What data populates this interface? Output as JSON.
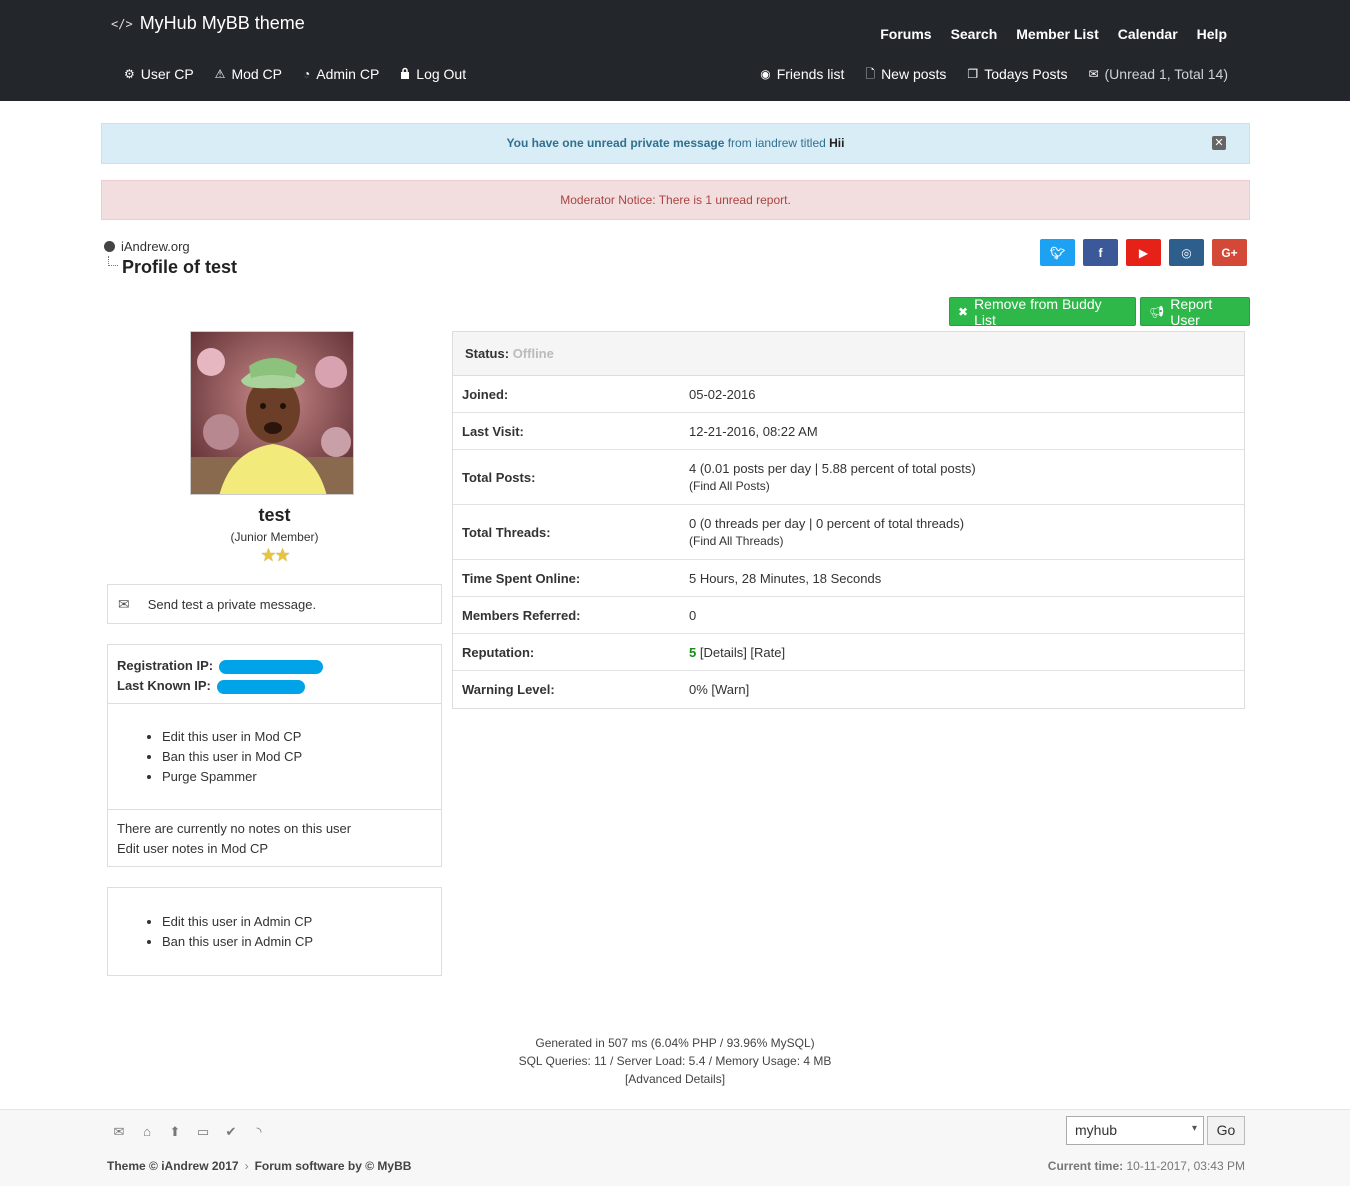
{
  "header": {
    "brand": "MyHub MyBB theme",
    "top_nav": [
      "Forums",
      "Search",
      "Member List",
      "Calendar",
      "Help"
    ],
    "user_nav": {
      "user_cp": "User CP",
      "mod_cp": "Mod CP",
      "admin_cp": "Admin CP",
      "logout": "Log Out"
    },
    "right_nav": {
      "friends": "Friends list",
      "new_posts": "New posts",
      "todays_posts": "Todays Posts",
      "pm_status": "(Unread 1, Total 14)"
    }
  },
  "alerts": {
    "pm_notice_strong": "You have one unread private message",
    "pm_from": "from",
    "pm_sender": "iandrew",
    "pm_titled": "titled",
    "pm_title": "Hii",
    "mod_notice": "Moderator Notice: There is 1 unread report."
  },
  "breadcrumb": {
    "site": "iAndrew.org",
    "page_title": "Profile of test"
  },
  "actions": {
    "remove_buddy": "Remove from Buddy List",
    "report_user": "Report User"
  },
  "profile": {
    "username": "test",
    "usertitle": "(Junior Member)",
    "stars": "★★",
    "send_pm": "Send test a private message.",
    "reg_ip_label": "Registration IP:",
    "last_ip_label": "Last Known IP:",
    "mod_links": [
      "Edit this user in Mod CP",
      "Ban this user in Mod CP",
      "Purge Spammer"
    ],
    "notes_text": "There are currently no notes on this user",
    "notes_link": "Edit user notes in Mod CP",
    "admin_links": [
      "Edit this user in Admin CP",
      "Ban this user in Admin CP"
    ]
  },
  "details": {
    "status_label": "Status:",
    "status_value": "Offline",
    "joined_label": "Joined:",
    "joined_value": "05-02-2016",
    "last_visit_label": "Last Visit:",
    "last_visit_value": "12-21-2016, 08:22 AM",
    "total_posts_label": "Total Posts:",
    "total_posts_value": "4 (0.01 posts per day | 5.88 percent of total posts)",
    "total_posts_link": "(Find All Posts)",
    "total_threads_label": "Total Threads:",
    "total_threads_value": "0 (0 threads per day | 0 percent of total threads)",
    "total_threads_link": "(Find All Threads)",
    "time_online_label": "Time Spent Online:",
    "time_online_value": "5 Hours, 28 Minutes, 18 Seconds",
    "referred_label": "Members Referred:",
    "referred_value": "0",
    "reputation_label": "Reputation:",
    "reputation_value": "5",
    "reputation_links": "[Details] [Rate]",
    "warning_label": "Warning Level:",
    "warning_value": "0% [Warn]"
  },
  "debug": {
    "line1": "Generated in 507 ms (6.04% PHP / 93.96% MySQL)",
    "line2": "SQL Queries: 11 / Server Load: 5.4 / Memory Usage: 4 MB",
    "line3": "[Advanced Details]"
  },
  "footer": {
    "theme_select": "myhub",
    "go": "Go",
    "credit_theme": "Theme © iAndrew 2017",
    "credit_software": "Forum software by © MyBB",
    "current_time_label": "Current time:",
    "current_time_value": "10-11-2017, 03:43 PM"
  },
  "colors": {
    "header_bg": "#23272c",
    "button_green": "#2fb84a",
    "twitter": "#1da1f2",
    "facebook": "#3b5998",
    "youtube": "#e62117",
    "instagram": "#2e5e8c",
    "googleplus": "#d34836"
  }
}
